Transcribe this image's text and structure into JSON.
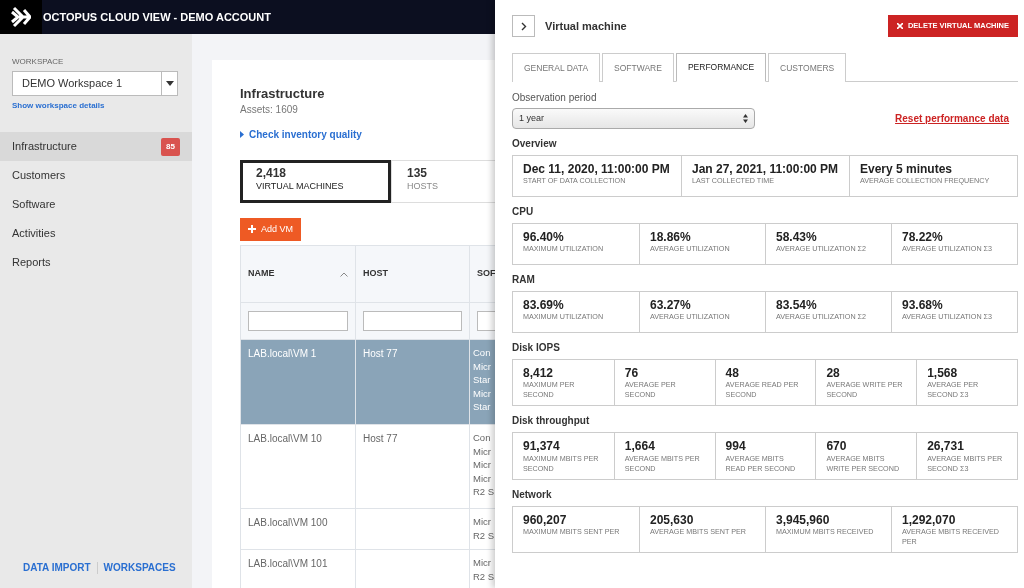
{
  "header": {
    "title": "OCTOPUS CLOUD VIEW - DEMO ACCOUNT"
  },
  "sidebar": {
    "workspace_label": "WORKSPACE",
    "workspace": "DEMO Workspace 1",
    "details_link": "Show workspace details",
    "items": [
      {
        "label": "Infrastructure",
        "selected": true,
        "badge": "85"
      },
      {
        "label": "Customers",
        "selected": false
      },
      {
        "label": "Software",
        "selected": false
      },
      {
        "label": "Activities",
        "selected": false
      },
      {
        "label": "Reports",
        "selected": false
      }
    ],
    "footer_links": [
      "DATA IMPORT",
      "WORKSPACES"
    ]
  },
  "main": {
    "title": "Infrastructure",
    "subtitle": "Assets: 1609",
    "check_link": "Check inventory quality",
    "counters": [
      {
        "value": "2,418",
        "label": "VIRTUAL MACHINES",
        "selected": true
      },
      {
        "value": "135",
        "label": "HOSTS",
        "selected": false
      }
    ],
    "add_button": "Add VM",
    "table": {
      "columns": [
        {
          "label": "NAME",
          "sorted": true
        },
        {
          "label": "HOST",
          "sorted": false
        },
        {
          "label": "SOF",
          "sorted": false
        }
      ],
      "rows": [
        {
          "selected": true,
          "cells": [
            "LAB.local\\VM 1",
            "Host 77",
            [
              "Con",
              "Micr",
              "Star",
              "Micr",
              "Star"
            ]
          ]
        },
        {
          "selected": false,
          "cells": [
            "LAB.local\\VM 10",
            "Host 77",
            [
              "Con",
              "Micr",
              "Micr",
              "Micr",
              "R2 S"
            ]
          ]
        },
        {
          "selected": false,
          "cells": [
            "LAB.local\\VM 100",
            "",
            [
              "Micr",
              "R2 S"
            ]
          ]
        },
        {
          "selected": false,
          "cells": [
            "LAB.local\\VM 101",
            "",
            [
              "Micr",
              "R2 S"
            ]
          ]
        }
      ]
    }
  },
  "panel": {
    "title": "Virtual machine",
    "delete_button": "DELETE VIRTUAL MACHINE",
    "tabs": [
      {
        "label": "GENERAL DATA",
        "selected": false
      },
      {
        "label": "SOFTWARE",
        "selected": false
      },
      {
        "label": "PERFORMANCE",
        "selected": true
      },
      {
        "label": "CUSTOMERS",
        "selected": false
      }
    ],
    "period_label": "Observation period",
    "period": "1 year",
    "reset_link": "Reset performance data",
    "sections": [
      {
        "title": "Overview",
        "metrics": [
          {
            "value": "Dec 11, 2020, 11:00:00 PM",
            "label": "START OF DATA COLLECTION"
          },
          {
            "value": "Jan 27, 2021, 11:00:00 PM",
            "label": "LAST COLLECTED TIME"
          },
          {
            "value": "Every 5 minutes",
            "label": "AVERAGE COLLECTION FREQUENCY"
          }
        ]
      },
      {
        "title": "CPU",
        "metrics": [
          {
            "value": "96.40%",
            "label": "MAXIMUM UTILIZATION"
          },
          {
            "value": "18.86%",
            "label": "AVERAGE UTILIZATION"
          },
          {
            "value": "58.43%",
            "label": "AVERAGE UTILIZATION Σ2"
          },
          {
            "value": "78.22%",
            "label": "AVERAGE UTILIZATION Σ3"
          }
        ]
      },
      {
        "title": "RAM",
        "metrics": [
          {
            "value": "83.69%",
            "label": "MAXIMUM UTILIZATION"
          },
          {
            "value": "63.27%",
            "label": "AVERAGE UTILIZATION"
          },
          {
            "value": "83.54%",
            "label": "AVERAGE UTILIZATION Σ2"
          },
          {
            "value": "93.68%",
            "label": "AVERAGE UTILIZATION Σ3"
          }
        ]
      },
      {
        "title": "Disk IOPS",
        "metrics": [
          {
            "value": "8,412",
            "label": "MAXIMUM PER SECOND"
          },
          {
            "value": "76",
            "label": "AVERAGE PER SECOND"
          },
          {
            "value": "48",
            "label": "AVERAGE READ PER SECOND"
          },
          {
            "value": "28",
            "label": "AVERAGE WRITE PER SECOND"
          },
          {
            "value": "1,568",
            "label": "AVERAGE PER SECOND Σ3"
          }
        ]
      },
      {
        "title": "Disk throughput",
        "metrics": [
          {
            "value": "91,374",
            "label": "MAXIMUM MBITS PER SECOND"
          },
          {
            "value": "1,664",
            "label": "AVERAGE MBITS PER SECOND"
          },
          {
            "value": "994",
            "label": "AVERAGE MBITS READ PER SECOND"
          },
          {
            "value": "670",
            "label": "AVERAGE MBITS WRITE PER SECOND"
          },
          {
            "value": "26,731",
            "label": "AVERAGE MBITS PER SECOND Σ3"
          }
        ]
      },
      {
        "title": "Network",
        "metrics": [
          {
            "value": "960,207",
            "label": "MAXIMUM MBITS SENT PER"
          },
          {
            "value": "205,630",
            "label": "AVERAGE MBITS SENT PER"
          },
          {
            "value": "3,945,960",
            "label": "MAXIMUM MBITS RECEIVED"
          },
          {
            "value": "1,292,070",
            "label": "AVERAGE MBITS RECEIVED PER"
          }
        ]
      }
    ]
  }
}
